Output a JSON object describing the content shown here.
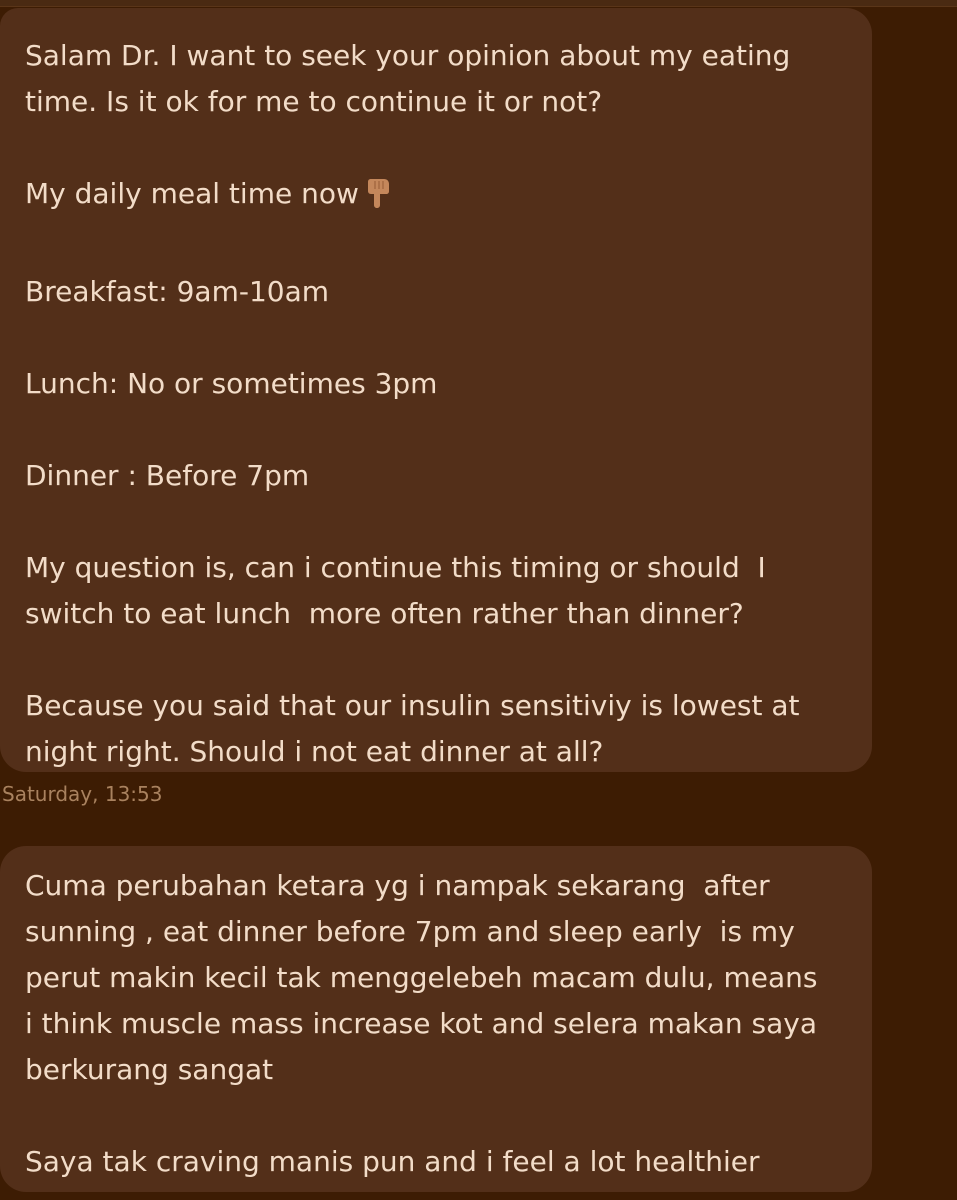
{
  "messages": [
    {
      "paragraphs": [
        "Salam Dr. I want to seek your opinion about my eating time. Is it ok for me to continue it or not?",
        "My daily meal time now",
        "Breakfast: 9am-10am",
        "Lunch: No or sometimes 3pm",
        "Dinner : Before 7pm",
        "My question is, can i continue this timing or should  I switch to eat lunch  more often rather than dinner?",
        "Because you said that our insulin sensitiviy is lowest at night right. Should i not eat dinner at all?"
      ],
      "emoji": "pointing-down-hand-icon"
    },
    {
      "paragraphs": [
        "Cuma perubahan ketara yg i nampak sekarang  after sunning , eat dinner before 7pm and sleep early  is my perut makin kecil tak menggelebeh macam dulu, means i think muscle mass increase kot and selera makan saya berkurang sangat",
        "Saya tak craving manis pun and i feel a lot healthier"
      ]
    }
  ],
  "timestamp": "Saturday, 13:53",
  "colors": {
    "background": "#3d1c03",
    "bubble": "#532f19",
    "text": "#f2dcc8",
    "timestamp": "#a9825f"
  }
}
